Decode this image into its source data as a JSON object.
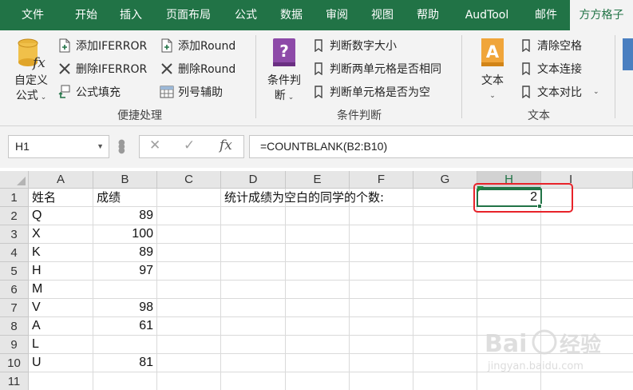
{
  "tabs": [
    "文件",
    "开始",
    "插入",
    "页面布局",
    "公式",
    "数据",
    "审阅",
    "视图",
    "帮助",
    "AudTool",
    "邮件",
    "方方格子"
  ],
  "ribbon": {
    "custom_formula": {
      "line1": "自定义",
      "line2": "公式"
    },
    "items": {
      "add_iferror": "添加IFERROR",
      "del_iferror": "删除IFERROR",
      "formula_fill": "公式填充",
      "add_round": "添加Round",
      "del_round": "删除Round",
      "col_helper": "列号辅助"
    },
    "group_quick": "便捷处理",
    "cond_judge": {
      "line1": "条件判",
      "line2": "断"
    },
    "cond_items": {
      "num_size": "判断数字大小",
      "two_cells_same": "判断两单元格是否相同",
      "cell_empty": "判断单元格是否为空"
    },
    "group_cond": "条件判断",
    "text_big": "文本",
    "text_items": {
      "clear_spaces": "清除空格",
      "text_concat": "文本连接",
      "text_compare": "文本对比"
    },
    "group_text": "文本",
    "colors": {
      "excel_green": "#217346",
      "highlight_red": "#e8232a"
    }
  },
  "formula_bar": {
    "name_box": "H1",
    "formula": "=COUNTBLANK(B2:B10)"
  },
  "grid": {
    "columns": [
      "A",
      "B",
      "C",
      "D",
      "E",
      "F",
      "G",
      "H",
      "I"
    ],
    "selected_column": "H",
    "rows": [
      "1",
      "2",
      "3",
      "4",
      "5",
      "6",
      "7",
      "8",
      "9",
      "10",
      "11"
    ],
    "header_a": "姓名",
    "header_b": "成绩",
    "names": [
      "Q",
      "X",
      "K",
      "H",
      "M",
      "V",
      "A",
      "L",
      "U"
    ],
    "scores": [
      "89",
      "100",
      "89",
      "97",
      "",
      "98",
      "61",
      "",
      "81"
    ],
    "d1_label": "统计成绩为空白的同学的个数:",
    "h1_value": "2"
  },
  "watermark": {
    "brand": "Bai",
    "brand2": "经验",
    "url": "jingyan.baidu.com"
  }
}
